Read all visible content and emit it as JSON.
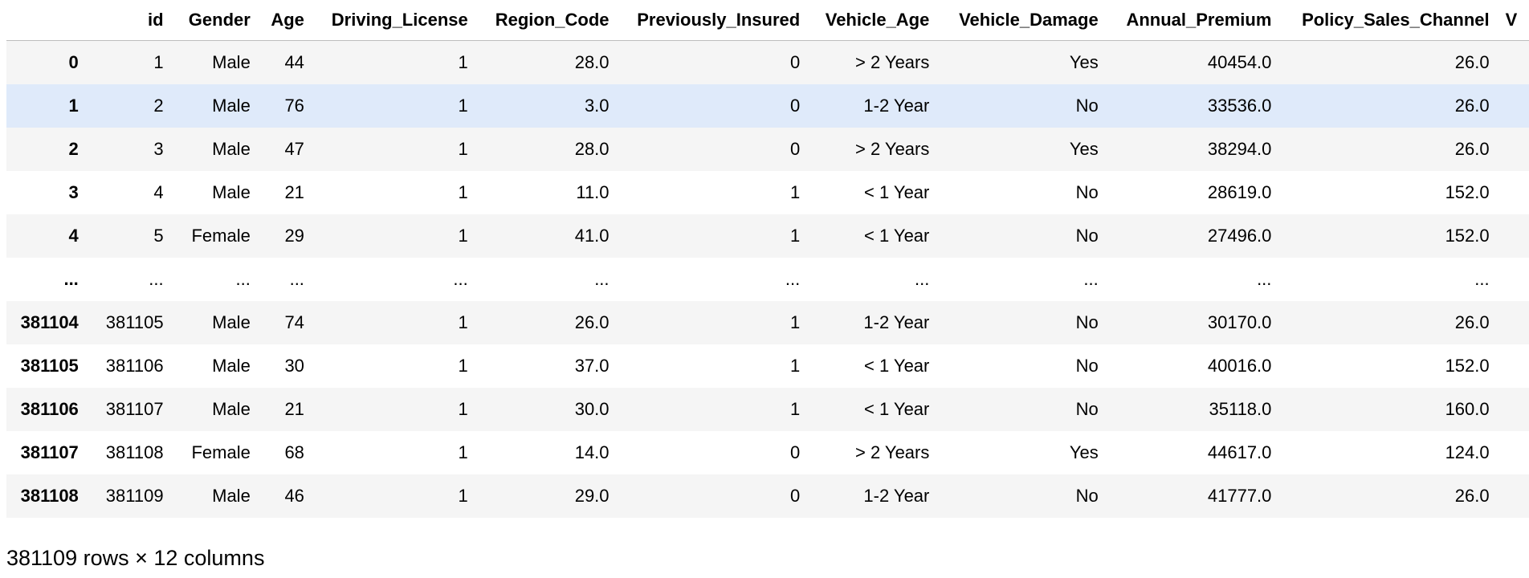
{
  "table": {
    "columns": [
      "",
      "id",
      "Gender",
      "Age",
      "Driving_License",
      "Region_Code",
      "Previously_Insured",
      "Vehicle_Age",
      "Vehicle_Damage",
      "Annual_Premium",
      "Policy_Sales_Channel",
      "V"
    ],
    "rows": [
      {
        "index": "0",
        "cells": [
          "1",
          "Male",
          "44",
          "1",
          "28.0",
          "0",
          "> 2 Years",
          "Yes",
          "40454.0",
          "26.0",
          ""
        ]
      },
      {
        "index": "1",
        "cells": [
          "2",
          "Male",
          "76",
          "1",
          "3.0",
          "0",
          "1-2 Year",
          "No",
          "33536.0",
          "26.0",
          ""
        ]
      },
      {
        "index": "2",
        "cells": [
          "3",
          "Male",
          "47",
          "1",
          "28.0",
          "0",
          "> 2 Years",
          "Yes",
          "38294.0",
          "26.0",
          ""
        ]
      },
      {
        "index": "3",
        "cells": [
          "4",
          "Male",
          "21",
          "1",
          "11.0",
          "1",
          "< 1 Year",
          "No",
          "28619.0",
          "152.0",
          ""
        ]
      },
      {
        "index": "4",
        "cells": [
          "5",
          "Female",
          "29",
          "1",
          "41.0",
          "1",
          "< 1 Year",
          "No",
          "27496.0",
          "152.0",
          ""
        ]
      },
      {
        "index": "...",
        "cells": [
          "...",
          "...",
          "...",
          "...",
          "...",
          "...",
          "...",
          "...",
          "...",
          "...",
          ""
        ]
      },
      {
        "index": "381104",
        "cells": [
          "381105",
          "Male",
          "74",
          "1",
          "26.0",
          "1",
          "1-2 Year",
          "No",
          "30170.0",
          "26.0",
          ""
        ]
      },
      {
        "index": "381105",
        "cells": [
          "381106",
          "Male",
          "30",
          "1",
          "37.0",
          "1",
          "< 1 Year",
          "No",
          "40016.0",
          "152.0",
          ""
        ]
      },
      {
        "index": "381106",
        "cells": [
          "381107",
          "Male",
          "21",
          "1",
          "30.0",
          "1",
          "< 1 Year",
          "No",
          "35118.0",
          "160.0",
          ""
        ]
      },
      {
        "index": "381107",
        "cells": [
          "381108",
          "Female",
          "68",
          "1",
          "14.0",
          "0",
          "> 2 Years",
          "Yes",
          "44617.0",
          "124.0",
          ""
        ]
      },
      {
        "index": "381108",
        "cells": [
          "381109",
          "Male",
          "46",
          "1",
          "29.0",
          "0",
          "1-2 Year",
          "No",
          "41777.0",
          "26.0",
          ""
        ]
      }
    ],
    "hovered_row": 1,
    "colors": {
      "odd_row": "#f5f5f5",
      "even_row": "#ffffff",
      "hover_row": "#dfeafa",
      "header_border": "#bdbdbd"
    }
  },
  "footer": {
    "summary": "381109 rows × 12 columns"
  }
}
